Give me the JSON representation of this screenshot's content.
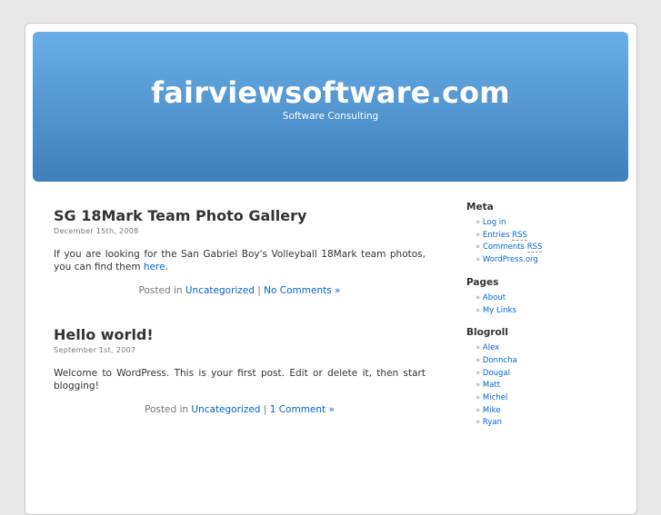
{
  "header": {
    "title": "fairviewsoftware.com",
    "description": "Software Consulting"
  },
  "posts": [
    {
      "title": "SG 18Mark Team Photo Gallery",
      "date": "December 15th, 2008",
      "body": "If you are looking for the San Gabriel Boy's Volleyball 18Mark team photos, you can find them ",
      "link": "here",
      "after": ".",
      "posted_in": "Posted in ",
      "category": "Uncategorized",
      "sep": " | ",
      "comments": "No Comments »"
    },
    {
      "title": "Hello world!",
      "date": "September 1st, 2007",
      "body": "Welcome to WordPress. This is your first post. Edit or delete it, then start blogging!",
      "posted_in": "Posted in ",
      "category": "Uncategorized",
      "sep": " | ",
      "comments": "1 Comment »"
    }
  ],
  "sidebar": {
    "meta": {
      "title": "Meta",
      "login": "Log in",
      "entries": "Entries",
      "comments": "Comments",
      "rss": "RSS",
      "wordpress": "WordPress.org"
    },
    "pages": {
      "title": "Pages",
      "items": [
        "About",
        "My Links"
      ]
    },
    "blogroll": {
      "title": "Blogroll",
      "items": [
        "Alex",
        "Donncha",
        "Dougal",
        "Matt",
        "Michel",
        "Mike",
        "Ryan"
      ]
    }
  }
}
